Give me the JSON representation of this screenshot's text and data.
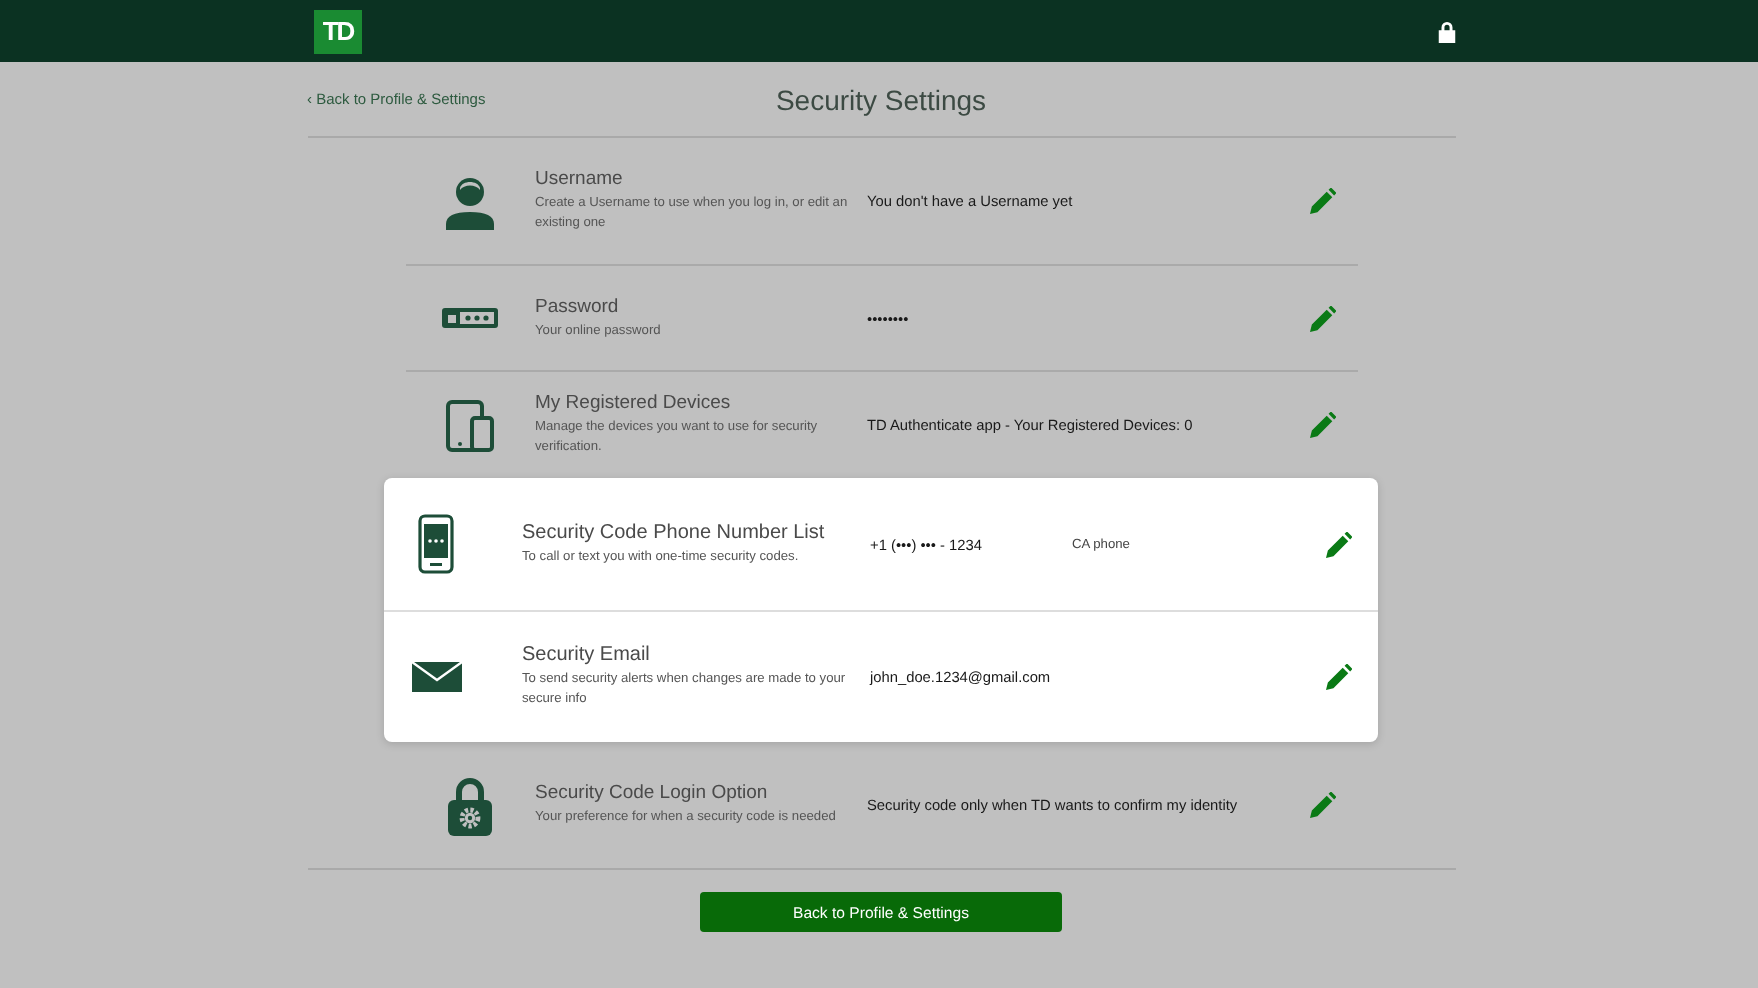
{
  "header": {
    "logo": "TD"
  },
  "back_link": "‹ Back to Profile & Settings",
  "title": "Security Settings",
  "rows": [
    {
      "kind": "person",
      "title": "Username",
      "description": "Create a Username to use when you log in, or edit an existing one",
      "value": "You don't have a Username yet",
      "highlighted": false
    },
    {
      "kind": "password",
      "title": "Password",
      "description": "Your online password",
      "value": "••••••••",
      "highlighted": false
    },
    {
      "kind": "devices",
      "title": "My Registered Devices",
      "description": "Manage the devices you want to use for security verification.",
      "value": "TD Authenticate app - Your Registered Devices: 0",
      "highlighted": false
    },
    {
      "kind": "phone",
      "title": "Security Code Phone Number List",
      "description": "To call or text you with one-time security codes.",
      "value": "+1 (•••) ••• - 1234",
      "extra": "CA phone",
      "highlighted": true
    },
    {
      "kind": "email",
      "title": "Security Email",
      "description": "To send security alerts when changes are made to your secure info",
      "value": "john_doe.1234@gmail.com",
      "highlighted": true
    },
    {
      "kind": "lock",
      "title": "Security Code Login Option",
      "description": "Your preference for when a security code is needed",
      "value": "Security code only when TD wants to confirm my identity",
      "highlighted": false
    }
  ],
  "button": "Back to Profile & Settings"
}
